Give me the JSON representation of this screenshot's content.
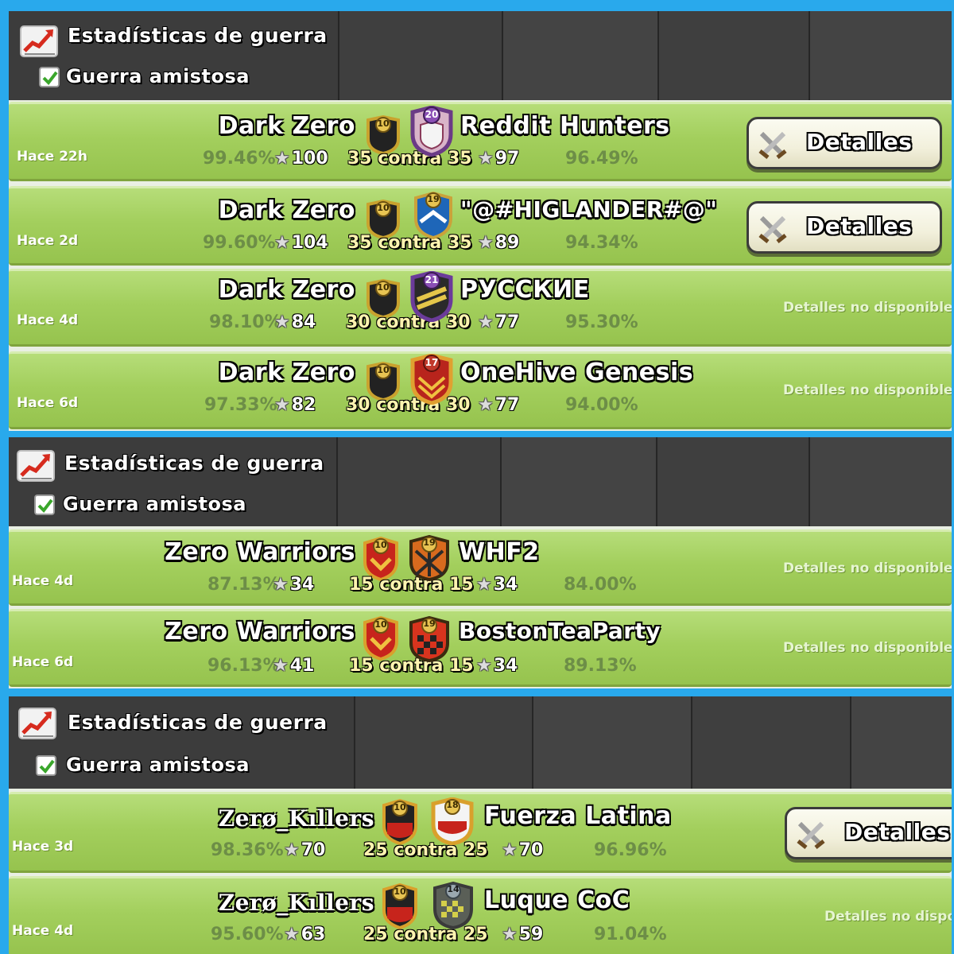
{
  "screens": [
    {
      "header": {
        "title": "Estadísticas de guerra",
        "subtitle": "Guerra amistosa"
      },
      "wars": [
        {
          "ago": "Hace 22h",
          "clan": "Dark Zero",
          "clan_level": "10",
          "clan_pct": "99.46%",
          "clan_stars": "100",
          "size": "35",
          "vs": "contra",
          "opp_size": "35",
          "opponent": "Reddit Hunters",
          "opp_level": "20",
          "opp_stars": "97",
          "opp_pct": "96.49%",
          "details": "Detalles"
        },
        {
          "ago": "Hace 2d",
          "clan": "Dark Zero",
          "clan_level": "10",
          "clan_pct": "99.60%",
          "clan_stars": "104",
          "size": "35",
          "vs": "contra",
          "opp_size": "35",
          "opponent": "\"@#HIGLANDER#@\"",
          "opp_level": "19",
          "opp_stars": "89",
          "opp_pct": "94.34%",
          "details": "Detalles"
        },
        {
          "ago": "Hace 4d",
          "clan": "Dark Zero",
          "clan_level": "10",
          "clan_pct": "98.10%",
          "clan_stars": "84",
          "size": "30",
          "vs": "contra",
          "opp_size": "30",
          "opponent": "РУССКИЕ",
          "opp_level": "21",
          "opp_stars": "77",
          "opp_pct": "95.30%",
          "details_na": "Detalles no disponibles"
        },
        {
          "ago": "Hace 6d",
          "clan": "Dark Zero",
          "clan_level": "10",
          "clan_pct": "97.33%",
          "clan_stars": "82",
          "size": "30",
          "vs": "contra",
          "opp_size": "30",
          "opponent": "OneHive Genesis",
          "opp_level": "17",
          "opp_stars": "77",
          "opp_pct": "94.00%",
          "details_na": "Detalles no disponibles"
        }
      ]
    },
    {
      "header": {
        "title": "Estadísticas de guerra",
        "subtitle": "Guerra amistosa"
      },
      "wars": [
        {
          "ago": "Hace 4d",
          "clan": "Zero Warriors",
          "clan_level": "10",
          "clan_pct": "87.13%",
          "clan_stars": "34",
          "size": "15",
          "vs": "contra",
          "opp_size": "15",
          "opponent": "WHF2",
          "opp_level": "19",
          "opp_stars": "34",
          "opp_pct": "84.00%",
          "details_na": "Detalles no disponibles"
        },
        {
          "ago": "Hace 6d",
          "clan": "Zero Warriors",
          "clan_level": "10",
          "clan_pct": "96.13%",
          "clan_stars": "41",
          "size": "15",
          "vs": "contra",
          "opp_size": "15",
          "opponent": "BostonTeaParty",
          "opp_level": "19",
          "opp_stars": "34",
          "opp_pct": "89.13%",
          "details_na": "Detalles no disponibles"
        }
      ]
    },
    {
      "header": {
        "title": "Estadísticas de guerra",
        "subtitle": "Guerra amistosa"
      },
      "wars": [
        {
          "ago": "Hace 3d",
          "clan": "Zerø_Kıllers",
          "clan_level": "10",
          "clan_pct": "98.36%",
          "clan_stars": "70",
          "size": "25",
          "vs": "contra",
          "opp_size": "25",
          "opponent": "Fuerza Latina",
          "opp_level": "18",
          "opp_stars": "70",
          "opp_pct": "96.96%",
          "details": "Detalles"
        },
        {
          "ago": "Hace 4d",
          "clan": "Zerø_Kıllers",
          "clan_level": "10",
          "clan_pct": "95.60%",
          "clan_stars": "63",
          "size": "25",
          "vs": "contra",
          "opp_size": "25",
          "opponent": "Luque CoC",
          "opp_level": "14",
          "opp_stars": "59",
          "opp_pct": "91.04%",
          "details_na": "Detalles no dispon"
        }
      ]
    }
  ],
  "colors": {
    "frame": "#29a9ec",
    "row": "#a3cf5d",
    "header": "#3c3c3c"
  }
}
